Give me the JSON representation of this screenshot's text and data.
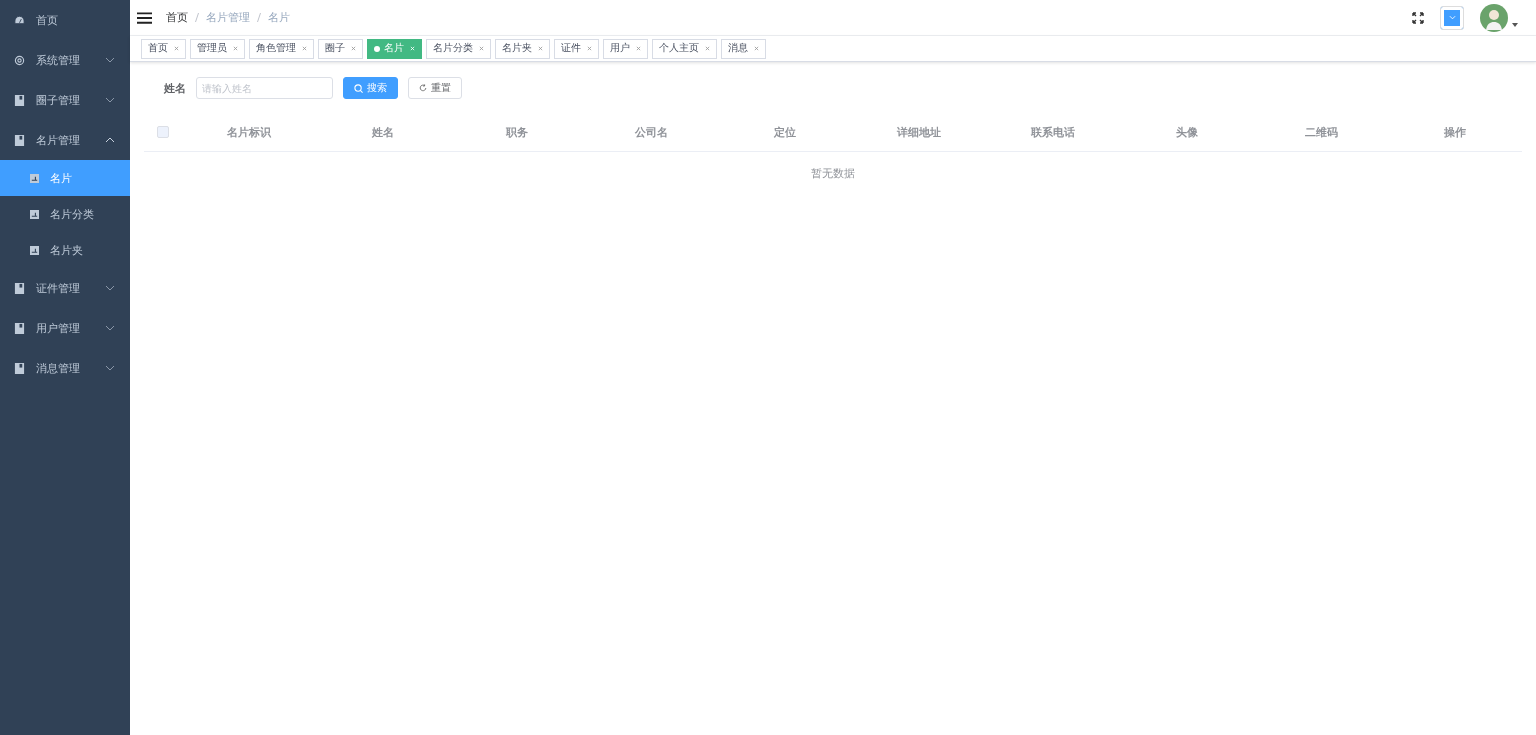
{
  "sidebar": {
    "items": [
      {
        "label": "首页"
      },
      {
        "label": "系统管理",
        "expanded": false
      },
      {
        "label": "圈子管理",
        "expanded": false
      },
      {
        "label": "名片管理",
        "expanded": true,
        "children": [
          {
            "label": "名片",
            "selected": true
          },
          {
            "label": "名片分类",
            "selected": false
          },
          {
            "label": "名片夹",
            "selected": false
          }
        ]
      },
      {
        "label": "证件管理",
        "expanded": false
      },
      {
        "label": "用户管理",
        "expanded": false
      },
      {
        "label": "消息管理",
        "expanded": false
      }
    ]
  },
  "breadcrumb": [
    "首页",
    "名片管理",
    "名片"
  ],
  "tags": [
    {
      "label": "首页",
      "selected": false
    },
    {
      "label": "管理员",
      "selected": false
    },
    {
      "label": "角色管理",
      "selected": false
    },
    {
      "label": "圈子",
      "selected": false
    },
    {
      "label": "名片",
      "selected": true
    },
    {
      "label": "名片分类",
      "selected": false
    },
    {
      "label": "名片夹",
      "selected": false
    },
    {
      "label": "证件",
      "selected": false
    },
    {
      "label": "用户",
      "selected": false
    },
    {
      "label": "个人主页",
      "selected": false
    },
    {
      "label": "消息",
      "selected": false
    }
  ],
  "search": {
    "label": "姓名",
    "placeholder": "请输入姓名",
    "search_button": "搜索",
    "reset_button": "重置"
  },
  "table": {
    "select_all_checked": false,
    "columns": [
      "名片标识",
      "姓名",
      "职务",
      "公司名",
      "定位",
      "详细地址",
      "联系电话",
      "头像",
      "二维码",
      "操作"
    ],
    "empty_text": "暂无数据"
  }
}
